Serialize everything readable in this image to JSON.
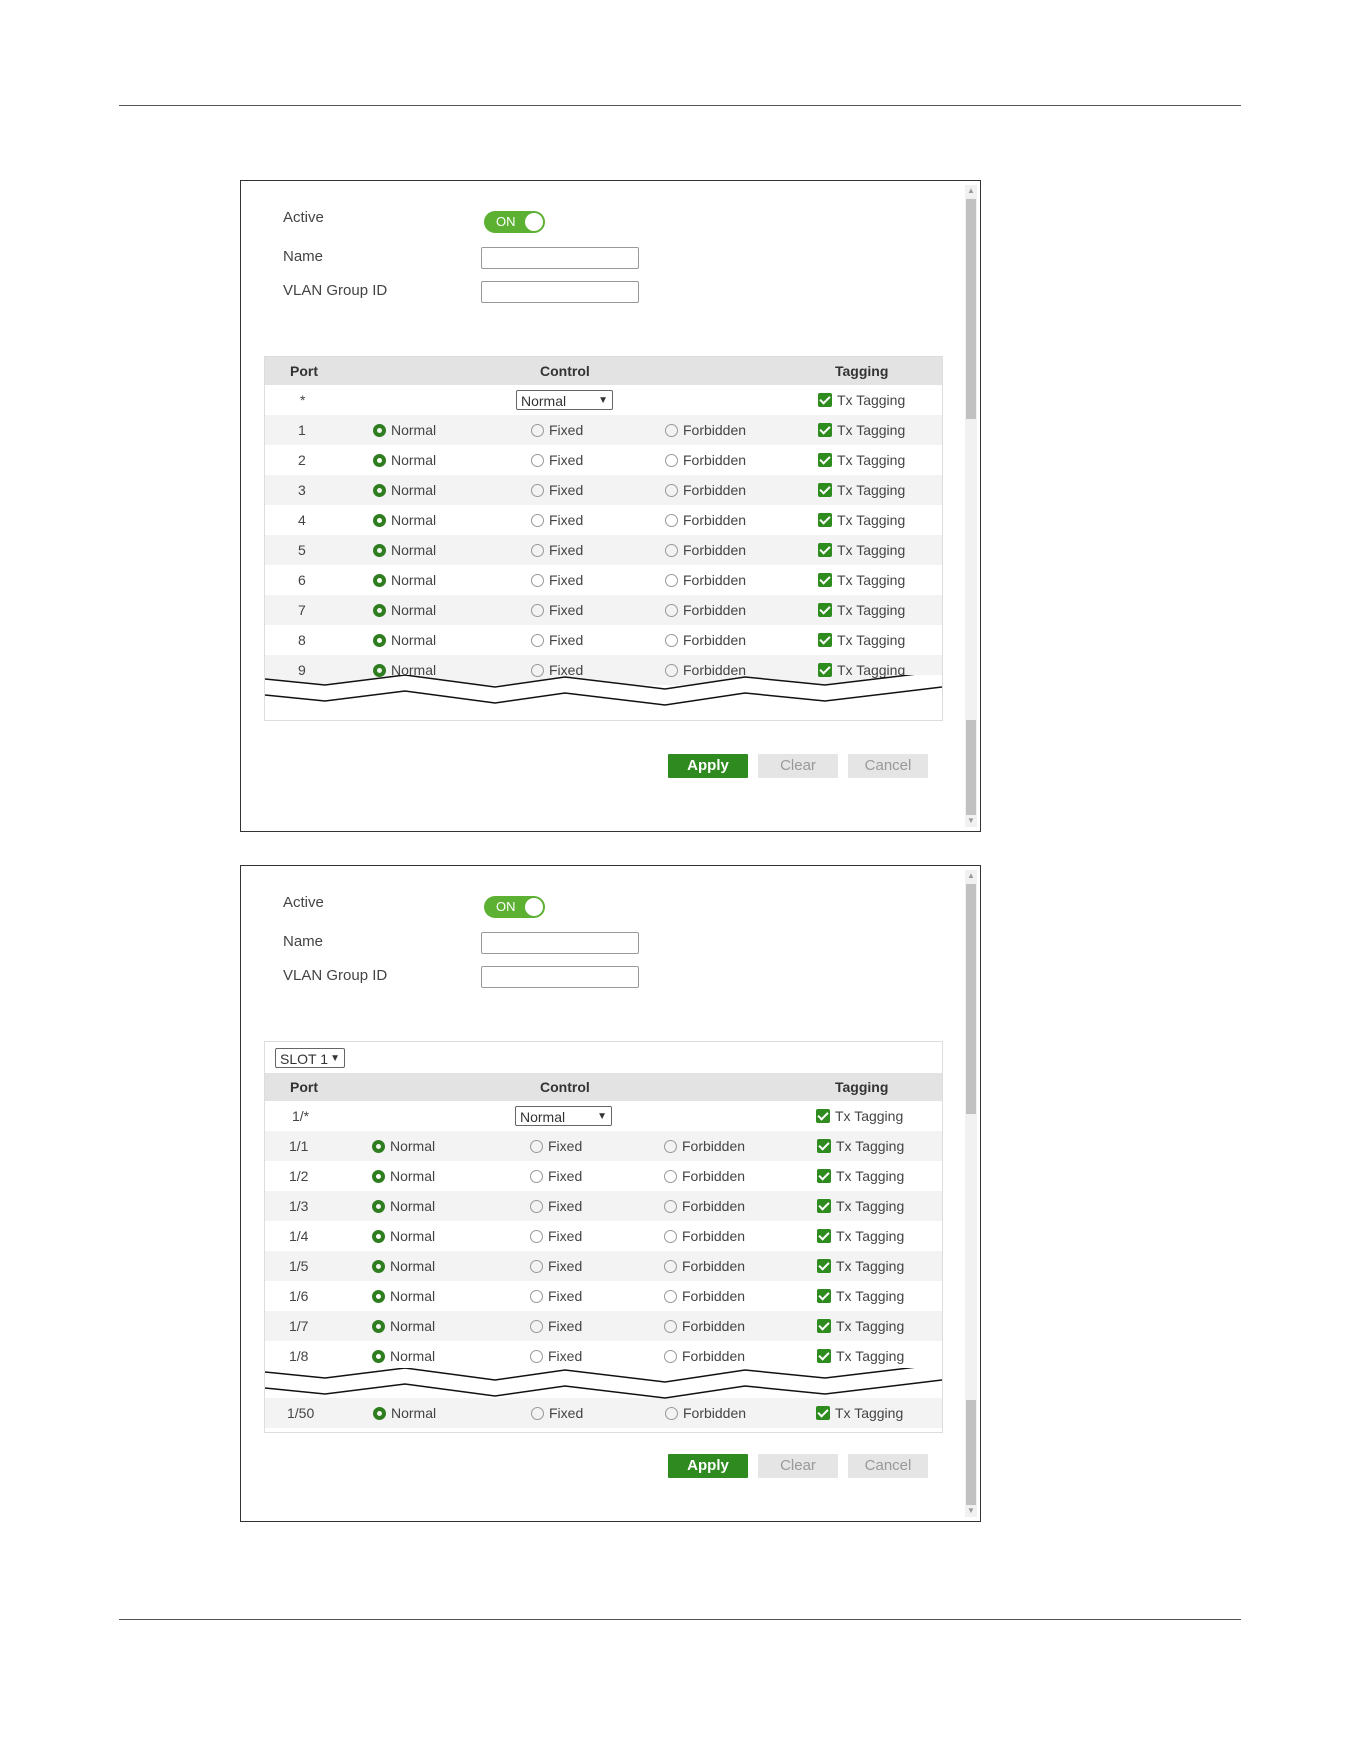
{
  "form": {
    "active_label": "Active",
    "toggle_text": "ON",
    "name_label": "Name",
    "vlan_group_id_label": "VLAN Group ID"
  },
  "table_headers": {
    "port": "Port",
    "control": "Control",
    "tagging": "Tagging"
  },
  "options": {
    "normal": "Normal",
    "fixed": "Fixed",
    "forbidden": "Forbidden",
    "tx_tagging": "Tx Tagging"
  },
  "buttons": {
    "apply": "Apply",
    "clear": "Clear",
    "cancel": "Cancel"
  },
  "colors": {
    "accent_green": "#2f8b20",
    "toggle_green": "#5cb032"
  },
  "panel1": {
    "all_port": "*",
    "all_select_value": "Normal",
    "rows": [
      {
        "port": "1"
      },
      {
        "port": "2"
      },
      {
        "port": "3"
      },
      {
        "port": "4"
      },
      {
        "port": "5"
      },
      {
        "port": "6"
      },
      {
        "port": "7"
      },
      {
        "port": "8"
      },
      {
        "port": "9"
      }
    ]
  },
  "panel2": {
    "slot_select": "SLOT 1",
    "all_port": "1/*",
    "all_select_value": "Normal",
    "rows": [
      {
        "port": "1/1"
      },
      {
        "port": "1/2"
      },
      {
        "port": "1/3"
      },
      {
        "port": "1/4"
      },
      {
        "port": "1/5"
      },
      {
        "port": "1/6"
      },
      {
        "port": "1/7"
      },
      {
        "port": "1/8"
      }
    ],
    "last_row": {
      "port": "1/50"
    }
  }
}
